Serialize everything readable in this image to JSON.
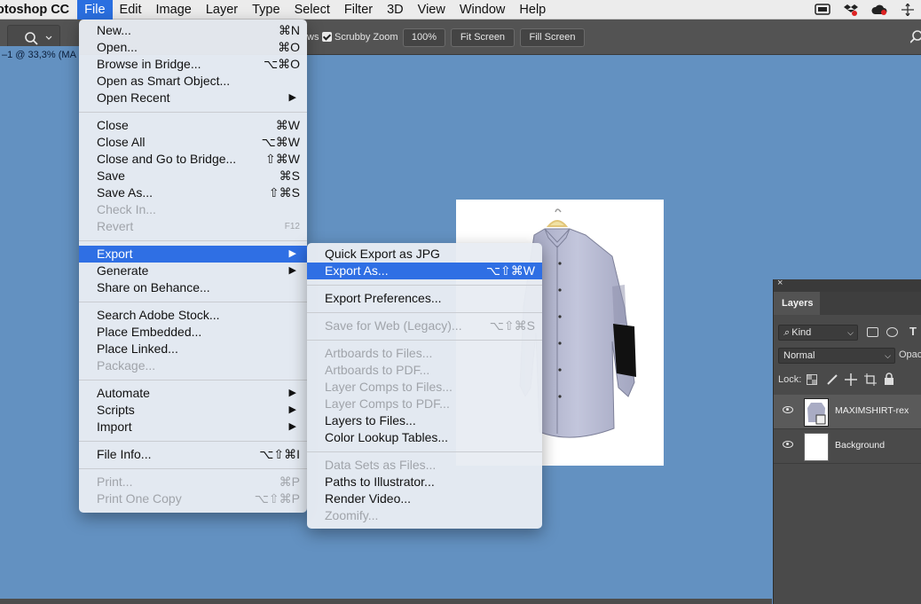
{
  "menubar": {
    "app_name": "otoshop CC",
    "items": [
      "File",
      "Edit",
      "Image",
      "Layer",
      "Type",
      "Select",
      "Filter",
      "3D",
      "View",
      "Window",
      "Help"
    ],
    "active": "File"
  },
  "options_bar": {
    "partial_label": "ws",
    "scrubby_zoom": "Scrubby Zoom",
    "zoom_100": "100%",
    "fit_screen": "Fit Screen",
    "fill_screen": "Fill Screen"
  },
  "document_tab": "–1 @ 33,3% (MA",
  "file_menu": [
    {
      "label": "New...",
      "shortcut": "⌘N"
    },
    {
      "label": "Open...",
      "shortcut": "⌘O"
    },
    {
      "label": "Browse in Bridge...",
      "shortcut": "⌥⌘O"
    },
    {
      "label": "Open as Smart Object...",
      "shortcut": ""
    },
    {
      "label": "Open Recent",
      "shortcut": "▶"
    },
    {
      "label": "Close",
      "shortcut": "⌘W"
    },
    {
      "label": "Close All",
      "shortcut": "⌥⌘W"
    },
    {
      "label": "Close and Go to Bridge...",
      "shortcut": "⇧⌘W"
    },
    {
      "label": "Save",
      "shortcut": "⌘S"
    },
    {
      "label": "Save As...",
      "shortcut": "⇧⌘S"
    },
    {
      "label": "Check In...",
      "shortcut": ""
    },
    {
      "label": "Revert",
      "shortcut": "F12"
    },
    {
      "label": "Export",
      "shortcut": "▶"
    },
    {
      "label": "Generate",
      "shortcut": "▶"
    },
    {
      "label": "Share on Behance...",
      "shortcut": ""
    },
    {
      "label": "Search Adobe Stock...",
      "shortcut": ""
    },
    {
      "label": "Place Embedded...",
      "shortcut": ""
    },
    {
      "label": "Place Linked...",
      "shortcut": ""
    },
    {
      "label": "Package...",
      "shortcut": ""
    },
    {
      "label": "Automate",
      "shortcut": "▶"
    },
    {
      "label": "Scripts",
      "shortcut": "▶"
    },
    {
      "label": "Import",
      "shortcut": "▶"
    },
    {
      "label": "File Info...",
      "shortcut": "⌥⇧⌘I"
    },
    {
      "label": "Print...",
      "shortcut": "⌘P"
    },
    {
      "label": "Print One Copy",
      "shortcut": "⌥⇧⌘P"
    }
  ],
  "export_menu": [
    {
      "label": "Quick Export as JPG",
      "shortcut": ""
    },
    {
      "label": "Export As...",
      "shortcut": "⌥⇧⌘W"
    },
    {
      "label": "Export Preferences...",
      "shortcut": ""
    },
    {
      "label": "Save for Web (Legacy)...",
      "shortcut": "⌥⇧⌘S"
    },
    {
      "label": "Artboards to Files...",
      "shortcut": ""
    },
    {
      "label": "Artboards to PDF...",
      "shortcut": ""
    },
    {
      "label": "Layer Comps to Files...",
      "shortcut": ""
    },
    {
      "label": "Layer Comps to PDF...",
      "shortcut": ""
    },
    {
      "label": "Layers to Files...",
      "shortcut": ""
    },
    {
      "label": "Color Lookup Tables...",
      "shortcut": ""
    },
    {
      "label": "Data Sets as Files...",
      "shortcut": ""
    },
    {
      "label": "Paths to Illustrator...",
      "shortcut": ""
    },
    {
      "label": "Render Video...",
      "shortcut": ""
    },
    {
      "label": "Zoomify...",
      "shortcut": ""
    }
  ],
  "layers_panel": {
    "close_glyph": "×",
    "tab": "Layers",
    "kind_filter": "Kind",
    "blend_mode": "Normal",
    "opacity_label": "Opac",
    "lock_label": "Lock:",
    "layers": [
      {
        "name": "MAXIMSHIRT-rex"
      },
      {
        "name": "Background"
      }
    ]
  },
  "colors": {
    "canvas": "#6391c1",
    "highlight": "#2f6fe4"
  }
}
